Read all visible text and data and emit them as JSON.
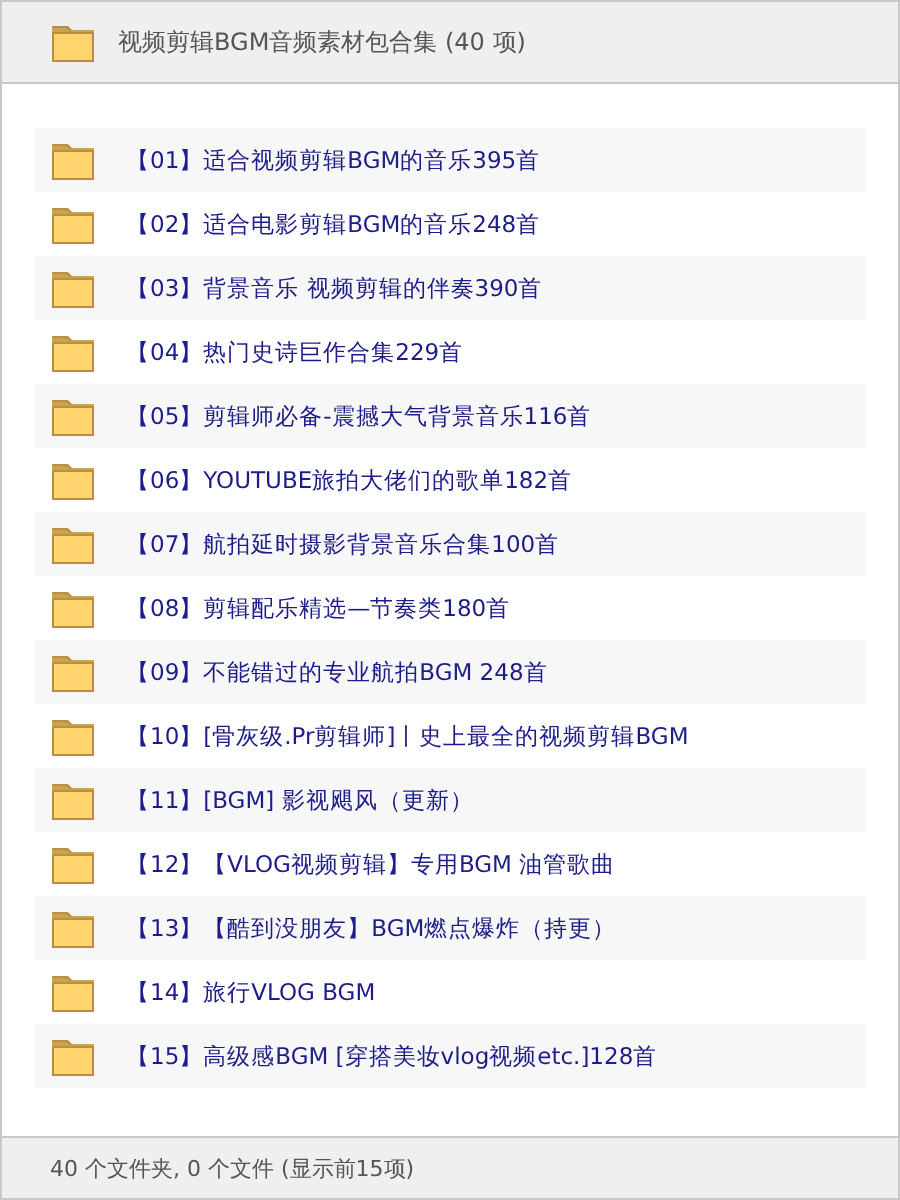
{
  "header": {
    "title": "视频剪辑BGM音频素材包合集 (40 项)"
  },
  "folders": [
    {
      "name": "【01】适合视频剪辑BGM的音乐395首"
    },
    {
      "name": "【02】适合电影剪辑BGM的音乐248首"
    },
    {
      "name": "【03】背景音乐  视频剪辑的伴奏390首"
    },
    {
      "name": "【04】热门史诗巨作合集229首"
    },
    {
      "name": "【05】剪辑师必备-震撼大气背景音乐116首"
    },
    {
      "name": "【06】YOUTUBE旅拍大佬们的歌单182首"
    },
    {
      "name": "【07】航拍延时摄影背景音乐合集100首"
    },
    {
      "name": "【08】剪辑配乐精选—节奏类180首"
    },
    {
      "name": "【09】不能错过的专业航拍BGM     248首"
    },
    {
      "name": "【10】[骨灰级.Pr剪辑师]丨史上最全的视频剪辑BGM"
    },
    {
      "name": "【11】[BGM] 影视飓风（更新）"
    },
    {
      "name": "【12】【VLOG视频剪辑】专用BGM 油管歌曲"
    },
    {
      "name": "【13】【酷到没朋友】BGM燃点爆炸（持更）"
    },
    {
      "name": "【14】旅行VLOG BGM"
    },
    {
      "name": "【15】高级感BGM [穿搭美妆vlog视频etc.]128首"
    }
  ],
  "status_bar": "40 个文件夹, 0 个文件 (显示前15项)"
}
